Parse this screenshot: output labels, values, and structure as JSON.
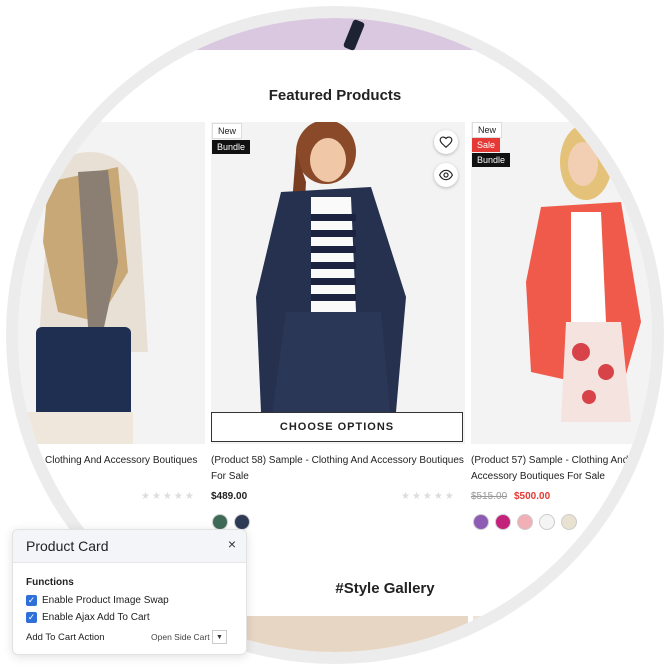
{
  "sections": {
    "featured_title": "Featured Products",
    "gallery_title": "#Style Gallery"
  },
  "products": [
    {
      "title": "Clothing And Accessory Boutiques",
      "swatch_colors": []
    },
    {
      "badges": [
        "New",
        "Bundle"
      ],
      "title": "(Product 58) Sample - Clothing And Accessory Boutiques For Sale",
      "price": "$489.00",
      "button": "CHOOSE OPTIONS",
      "swatch_colors": [
        "#3e6b57",
        "#2f3a55"
      ]
    },
    {
      "badges": [
        "New",
        "Sale",
        "Bundle"
      ],
      "title": "(Product 57) Sample - Clothing And Accessory Boutiques For Sale",
      "old_price": "$515.00",
      "price": "$500.00",
      "swatch_colors": [
        "#8e5bb5",
        "#c2227a",
        "#f0b0b5",
        "#f4f4f4",
        "#e9e2d0"
      ]
    }
  ],
  "rating_stars": "★★★★★",
  "icons": {
    "wishlist": "heart-icon",
    "quickview": "eye-icon",
    "close": "close-icon",
    "dropdown": "chevron-down-icon"
  },
  "panel": {
    "title": "Product Card",
    "close": "×",
    "section": "Functions",
    "options": [
      {
        "label": "Enable Product Image Swap",
        "checked": true
      },
      {
        "label": "Enable Ajax Add To Cart",
        "checked": true
      }
    ],
    "action_label": "Add To Cart Action",
    "action_value": "Open Side Cart",
    "action_arrow": "▼"
  }
}
